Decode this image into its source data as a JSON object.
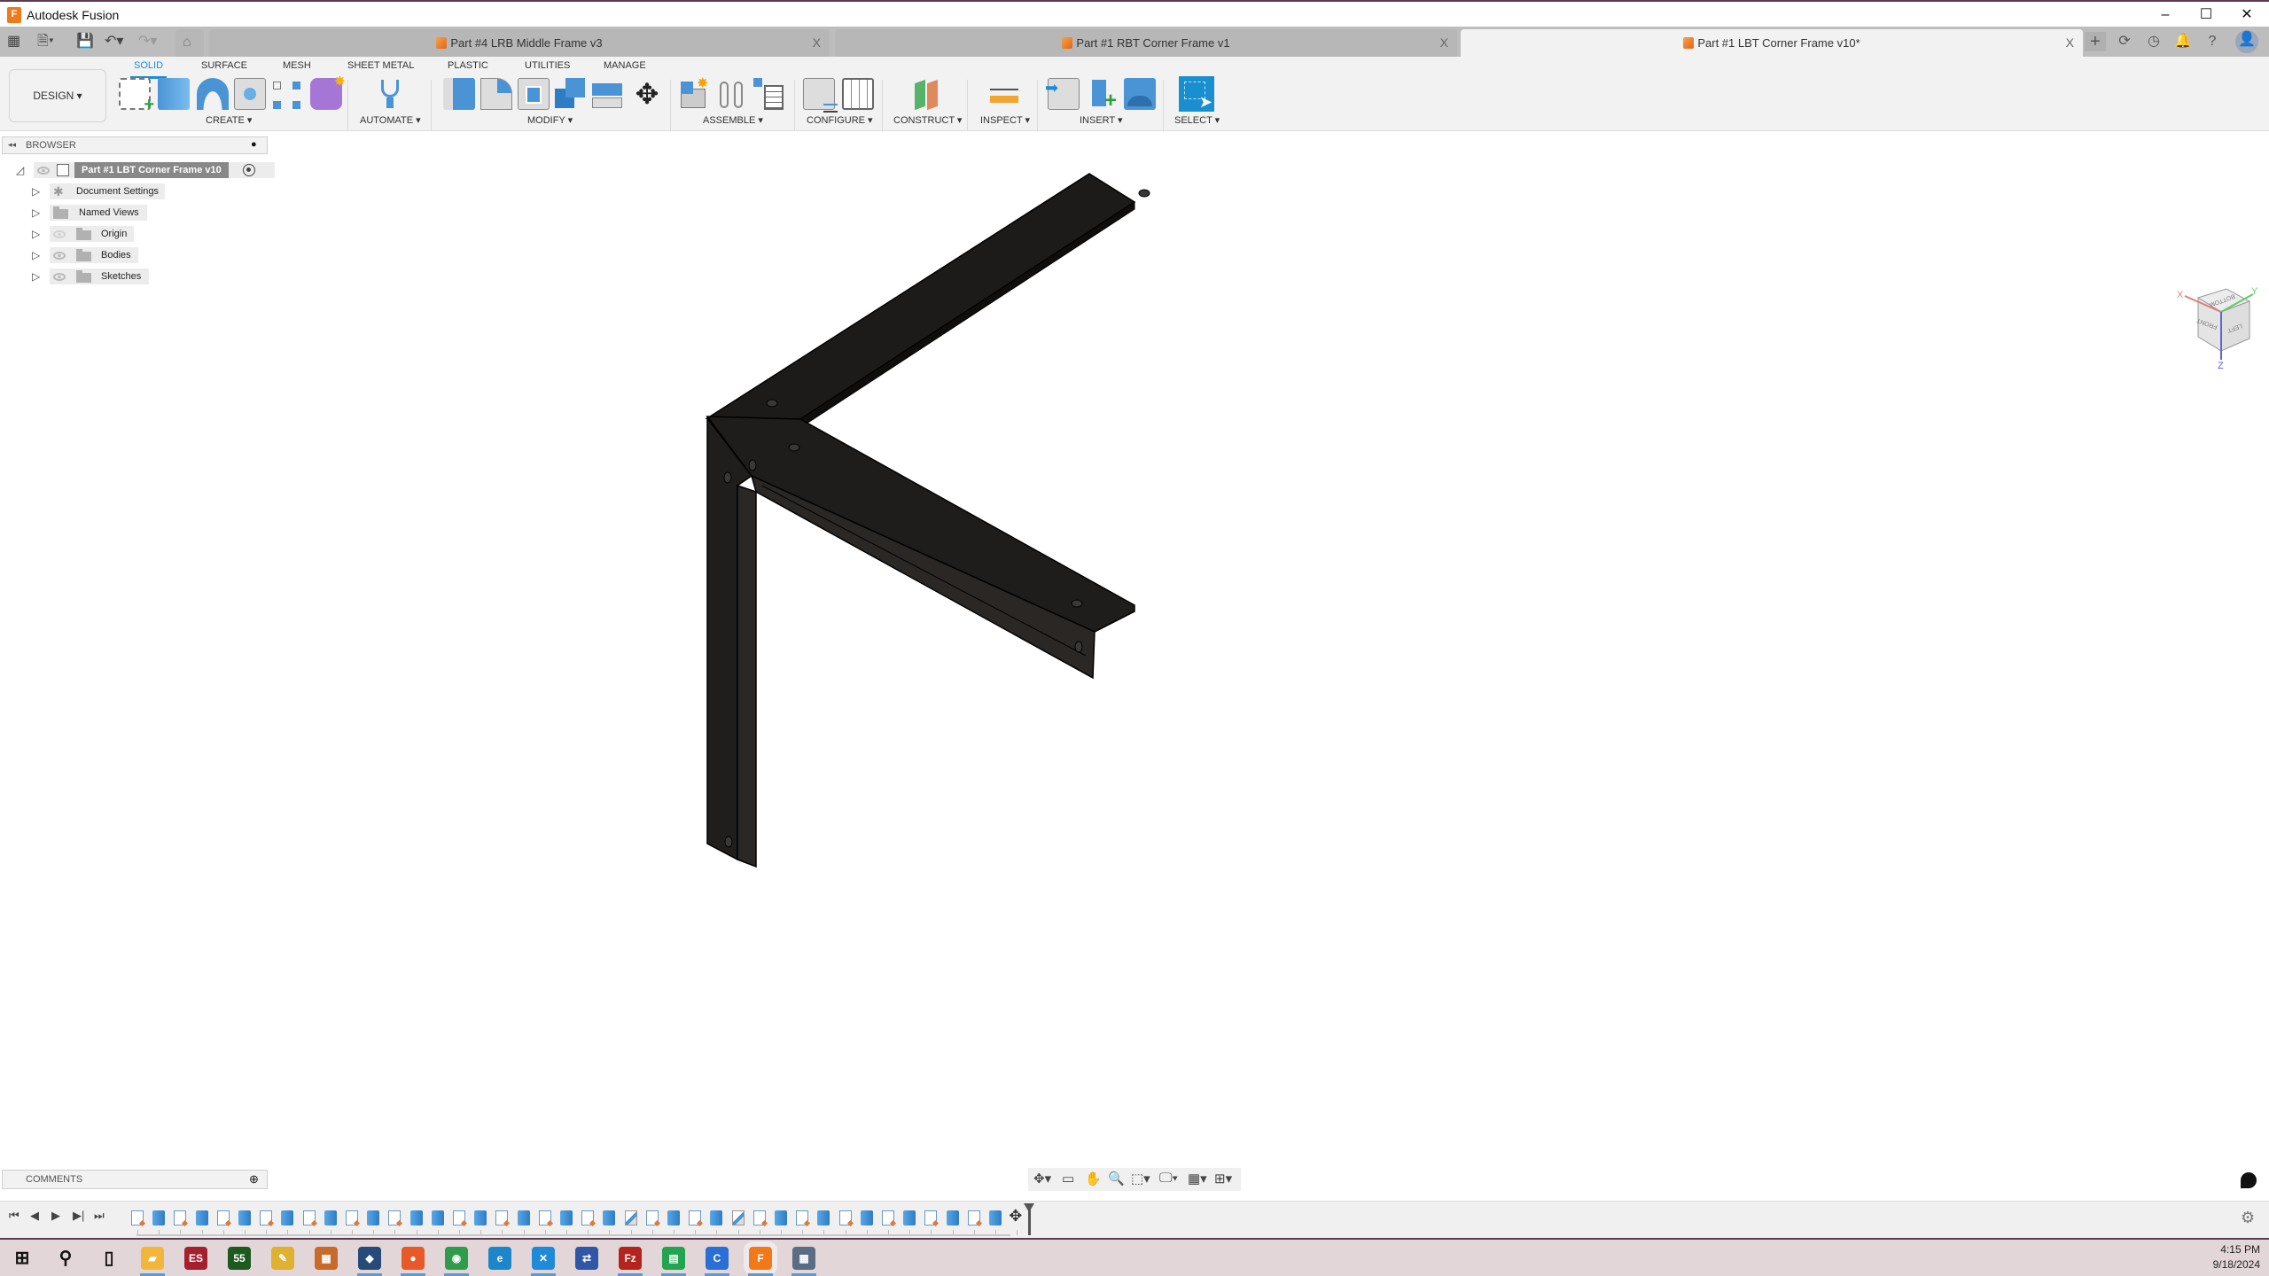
{
  "window": {
    "title": "Autodesk Fusion",
    "app_icon_letter": "F",
    "minimize": "–",
    "maximize": "☐",
    "close": "✕"
  },
  "quick_access": {
    "grid_icon": "▦",
    "file_icon": "🗎▾",
    "save_icon": "💾",
    "undo_icon": "↶▾",
    "redo_icon": "↷▾",
    "home_icon": "⌂"
  },
  "tabs": [
    {
      "label": "Part #4 LRB Middle Frame v3",
      "close": "X",
      "active": false
    },
    {
      "label": "Part #1 RBT Corner Frame v1",
      "close": "X",
      "active": false
    },
    {
      "label": "Part #1 LBT Corner Frame v10*",
      "close": "X",
      "active": true
    }
  ],
  "header_icons": {
    "new_tab": "+",
    "extensions": "⟳",
    "job_status": "◷",
    "notifications": "🔔",
    "help": "?",
    "profile": "👤"
  },
  "workspace": {
    "label": "DESIGN ▾"
  },
  "ribbon_tabs": [
    "SOLID",
    "SURFACE",
    "MESH",
    "SHEET METAL",
    "PLASTIC",
    "UTILITIES",
    "MANAGE"
  ],
  "active_ribbon_tab": "SOLID",
  "groups": [
    {
      "label": "CREATE ▾"
    },
    {
      "label": "AUTOMATE ▾"
    },
    {
      "label": "MODIFY ▾"
    },
    {
      "label": "ASSEMBLE ▾"
    },
    {
      "label": "CONFIGURE ▾"
    },
    {
      "label": "CONSTRUCT ▾"
    },
    {
      "label": "INSPECT ▾"
    },
    {
      "label": "INSERT ▾"
    },
    {
      "label": "SELECT ▾"
    }
  ],
  "tools": {
    "create": [
      "create-sketch",
      "extrude",
      "revolve",
      "hole",
      "pattern",
      "create-form"
    ],
    "automate": [
      "automate"
    ],
    "modify": [
      "press-pull",
      "fillet",
      "shell",
      "combine",
      "offset-face",
      "move-copy"
    ],
    "assemble": [
      "new-component",
      "joint",
      "bill-of-materials"
    ],
    "configure": [
      "configure-table",
      "configure-params"
    ],
    "construct": [
      "offset-plane"
    ],
    "inspect": [
      "measure"
    ],
    "insert": [
      "insert-derive",
      "insert-mcmaster",
      "insert-canvas"
    ],
    "select": [
      "select"
    ]
  },
  "browser": {
    "title": "BROWSER",
    "collapse_icon": "◂◂",
    "pin_icon": "●",
    "root": {
      "label": "Part #1 LBT Corner Frame v10"
    },
    "items": [
      {
        "label": "Document Settings",
        "icon": "gear-icon",
        "eye": null
      },
      {
        "label": "Named Views",
        "icon": "folder-icon",
        "eye": null
      },
      {
        "label": "Origin",
        "icon": "folder-icon",
        "eye": "hidden"
      },
      {
        "label": "Bodies",
        "icon": "folder-icon",
        "eye": "visible"
      },
      {
        "label": "Sketches",
        "icon": "folder-icon",
        "eye": "visible"
      }
    ]
  },
  "viewcube": {
    "faces": [
      "BOTTOM",
      "FRONT",
      "LEFT"
    ],
    "axes": [
      "X",
      "Y",
      "Z"
    ]
  },
  "comments": {
    "title": "COMMENTS",
    "add_icon": "⊕"
  },
  "nav_bar": [
    "orbit",
    "look-at",
    "pan",
    "zoom",
    "fit",
    "display-settings",
    "grid-settings",
    "viewports"
  ],
  "timeline": {
    "controls": [
      "⏮",
      "◀",
      "▶",
      "▶|",
      "⏭"
    ],
    "features": [
      "sketch",
      "extrude",
      "sketch",
      "extrude",
      "sketch",
      "extrude",
      "sketch",
      "extrude",
      "sketch",
      "extrude",
      "sketch",
      "extrude",
      "sketch",
      "extrude",
      "extrude",
      "sketch",
      "extrude",
      "sketch",
      "extrude",
      "sketch",
      "extrude",
      "sketch",
      "extrude",
      "chamfer",
      "sketch",
      "extrude",
      "sketch",
      "extrude",
      "chamfer",
      "sketch",
      "extrude",
      "sketch",
      "extrude",
      "sketch",
      "extrude",
      "sketch",
      "extrude",
      "sketch",
      "extrude",
      "sketch",
      "extrude",
      "move"
    ],
    "settings_icon": "⚙"
  },
  "taskbar": {
    "apps": [
      {
        "name": "start",
        "glyph": "⊞",
        "color": "#111111",
        "running": false
      },
      {
        "name": "search",
        "glyph": "⚲",
        "color": "#111111",
        "running": false
      },
      {
        "name": "task-view",
        "glyph": "▯",
        "color": "#111111",
        "running": false
      },
      {
        "name": "file-explorer",
        "glyph": "▰",
        "color": "#f2b63a",
        "running": true
      },
      {
        "name": "es-app",
        "glyph": "ES",
        "color": "#a4202e",
        "running": false
      },
      {
        "name": "app-55",
        "glyph": "55",
        "color": "#1e5a1e",
        "running": false
      },
      {
        "name": "feather-app",
        "glyph": "✎",
        "color": "#e0b030",
        "running": false
      },
      {
        "name": "colorful-app",
        "glyph": "▦",
        "color": "#c86a2a",
        "running": false
      },
      {
        "name": "virtualbox",
        "glyph": "◆",
        "color": "#264b78",
        "running": true
      },
      {
        "name": "firefox",
        "glyph": "●",
        "color": "#e8592a",
        "running": true
      },
      {
        "name": "chrome",
        "glyph": "◉",
        "color": "#2e9c4a",
        "running": true
      },
      {
        "name": "edge",
        "glyph": "e",
        "color": "#1b86c9",
        "running": false
      },
      {
        "name": "vscode",
        "glyph": "✕",
        "color": "#1f8ad8",
        "running": true
      },
      {
        "name": "network-app",
        "glyph": "⇄",
        "color": "#3056a6",
        "running": false
      },
      {
        "name": "filezilla",
        "glyph": "Fz",
        "color": "#b4241f",
        "running": true
      },
      {
        "name": "sheets-app",
        "glyph": "▤",
        "color": "#23a451",
        "running": true
      },
      {
        "name": "c-app",
        "glyph": "C",
        "color": "#2a6fd6",
        "running": true
      },
      {
        "name": "fusion",
        "glyph": "F",
        "color": "#f07a1a",
        "running": true
      },
      {
        "name": "calculator",
        "glyph": "▦",
        "color": "#596d85",
        "running": true
      }
    ],
    "time": "4:15 PM",
    "date": "9/18/2024"
  },
  "colors": {
    "accent": "#1a8fd0",
    "model": "#1e1c1a",
    "titlebar_border": "#5a3b50",
    "taskbar": "#e3d6d8"
  }
}
